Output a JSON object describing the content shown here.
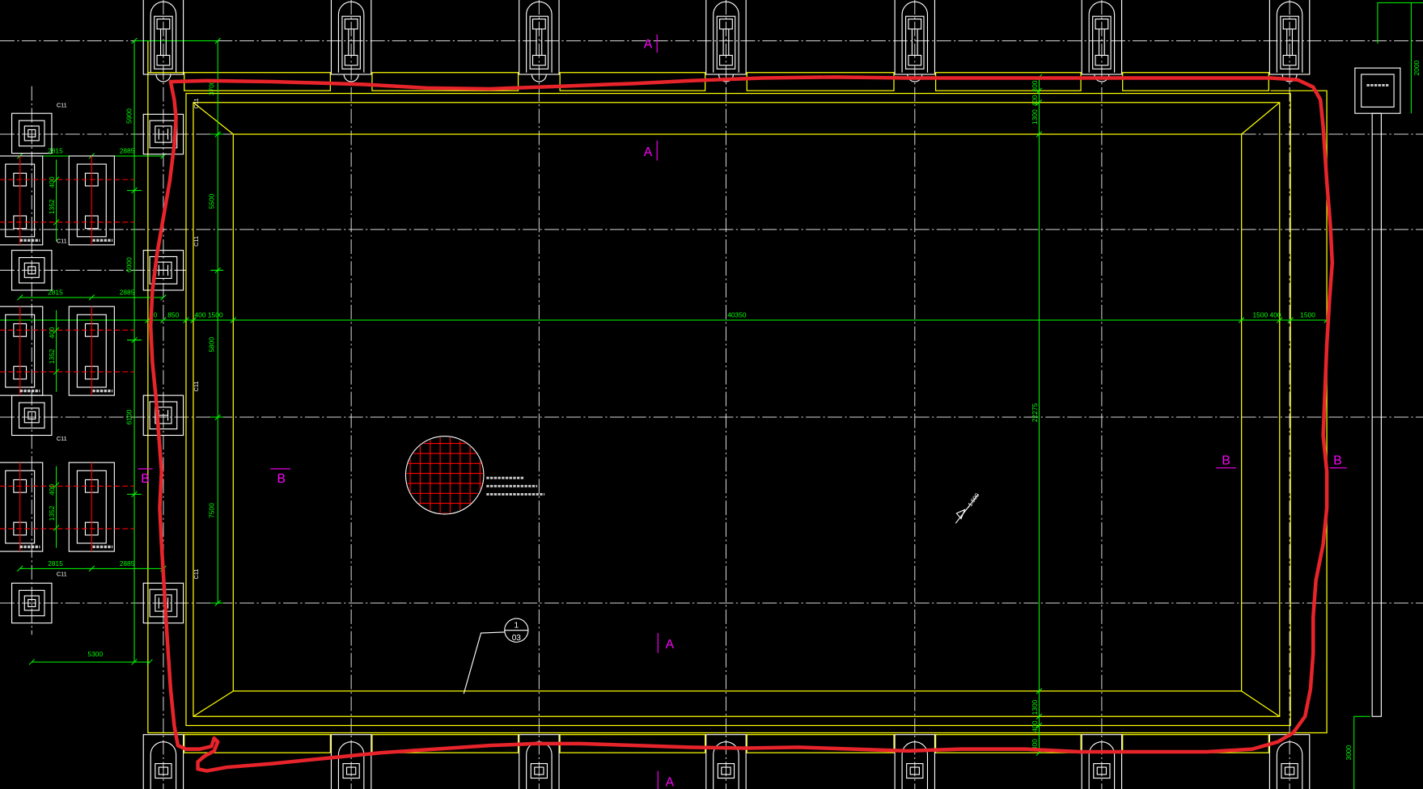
{
  "colors": {
    "background": "#000000",
    "outline": "#ffff00",
    "dimension": "#00ff00",
    "grid": "#ffffff",
    "section_mark": "#ff00ff",
    "rebar": "#ff0000",
    "markup": "#e8242b"
  },
  "section_marks": {
    "a_top_outer": "A",
    "a_top_inner": "A",
    "a_bottom_inner": "A",
    "a_bottom_outer": "A",
    "b_left_outer": "B",
    "b_left_inner": "B",
    "b_right_inner": "B",
    "b_right_outer": "B"
  },
  "left_piles": {
    "cap_tags": [
      "C11",
      "C11",
      "C11",
      "C11"
    ],
    "column_tags": [
      "C11",
      "C11",
      "C11",
      "C11"
    ],
    "spacing_left": [
      "2815",
      "2815",
      "2815"
    ],
    "spacing_right": [
      "2885",
      "2885",
      "2885"
    ],
    "pile_offsets": [
      {
        "a": "400",
        "b": "1352"
      },
      {
        "a": "400",
        "b": "1352"
      },
      {
        "a": "400",
        "b": "1352"
      }
    ],
    "bay_heights": [
      "5900",
      "6000",
      "6100"
    ],
    "bottom_width": "5300"
  },
  "pit": {
    "left_dims": [
      "3700",
      "5500",
      "5800",
      "7500"
    ],
    "width_chain": [
      "50",
      "850",
      "400 1500",
      "40350",
      "1500 400",
      "1500"
    ],
    "height_total": "22275",
    "top_chain": [
      "800",
      "400",
      "1300"
    ],
    "bottom_chain": [
      "1300",
      "400",
      "800"
    ],
    "elevation": "-1.500",
    "detail_callout": {
      "number": "1",
      "sheet": "03"
    }
  },
  "right_side": {
    "top_dim": "2000",
    "bottom_dim": "3000"
  }
}
